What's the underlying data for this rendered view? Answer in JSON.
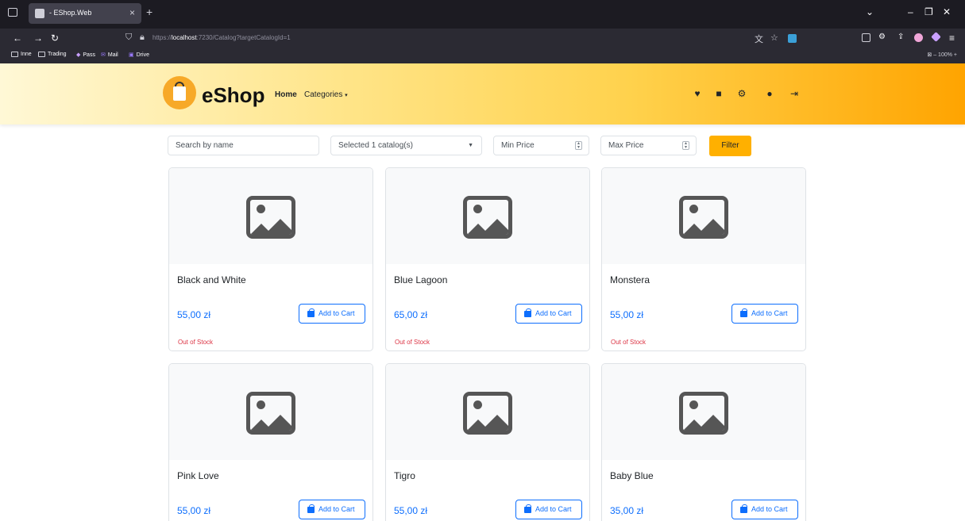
{
  "browser": {
    "tab_title": "- EShop.Web",
    "tab_close": "×",
    "new_tab": "+",
    "url_prefix": "https://",
    "url_host": "localhost",
    "url_rest": ":7230/Catalog?targetCatalogId=1",
    "bookmarks": [
      "Inne",
      "Trading",
      "Pass",
      "Mail",
      "Drive"
    ],
    "zoom": "100%",
    "icons": [
      "tab-list-icon",
      "back-icon",
      "forward-icon",
      "reload-icon",
      "shield-icon",
      "lock-icon",
      "translate-icon",
      "star-icon",
      "extension-icon",
      "sidebar-icon",
      "menu-icon"
    ]
  },
  "header": {
    "brand": "eShop",
    "nav": {
      "home": "Home",
      "categories": "Categories"
    },
    "icons": [
      "heart-icon",
      "bag-icon",
      "gear-icon",
      "user-icon",
      "logout-icon"
    ],
    "colors": {
      "gradient_start": "#fff8d6",
      "gradient_end": "#ffa400",
      "logo": "#f7a928"
    }
  },
  "filters": {
    "search_placeholder": "Search by name",
    "catalog_selected": "Selected 1 catalog(s)",
    "min_price_placeholder": "Min Price",
    "max_price_placeholder": "Max Price",
    "filter_label": "Filter",
    "filter_color": "#ffb000"
  },
  "products": [
    {
      "name": "Black and White",
      "price": "55,00 zł",
      "cart_label": "Add to Cart",
      "stock": "Out of Stock"
    },
    {
      "name": "Blue Lagoon",
      "price": "65,00 zł",
      "cart_label": "Add to Cart",
      "stock": "Out of Stock"
    },
    {
      "name": "Monstera",
      "price": "55,00 zł",
      "cart_label": "Add to Cart",
      "stock": "Out of Stock"
    },
    {
      "name": "Pink Love",
      "price": "55,00 zł",
      "cart_label": "Add to Cart",
      "stock": ""
    },
    {
      "name": "Tigro",
      "price": "55,00 zł",
      "cart_label": "Add to Cart",
      "stock": ""
    },
    {
      "name": "Baby Blue",
      "price": "35,00 zł",
      "cart_label": "Add to Cart",
      "stock": ""
    }
  ],
  "colors": {
    "price": "#0d6efd",
    "out_of_stock": "#dc3545"
  }
}
